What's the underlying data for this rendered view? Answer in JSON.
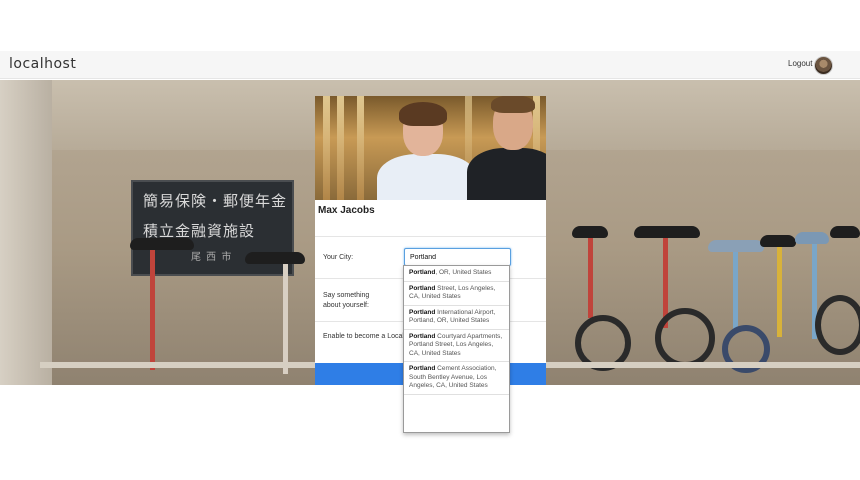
{
  "navbar": {
    "brand": "localhost",
    "logout_label": "Logout"
  },
  "background_sign": {
    "line1": "簡易保険・郵便年金",
    "line2": "積立金融資施設",
    "line3": "尾 西 市"
  },
  "profile": {
    "name": "Max Jacobs"
  },
  "form": {
    "city_label": "Your City:",
    "city_value": "Portland",
    "about_label_1": "Say something",
    "about_label_2": "about yourself:",
    "local_label": "Enable to become a Local"
  },
  "suggestions": [
    {
      "match": "Portland",
      "rest": ", OR, United States"
    },
    {
      "match": "Portland",
      "rest": " Street, Los Angeles, CA, United States"
    },
    {
      "match": "Portland",
      "rest": " International Airport, Portland, OR, United States"
    },
    {
      "match": "Portland",
      "rest": " Courtyard Apartments, Portland Street, Los Angeles, CA, United States"
    },
    {
      "match": "Portland",
      "rest": " Cement Association, South Bentley Avenue, Los Angeles, CA, United States"
    }
  ],
  "colors": {
    "accent": "#2f7ee6",
    "input_focus": "#5aa0e0",
    "navbar_bg": "#f6f6f6"
  },
  "icons": {
    "avatar": "user-avatar-photo"
  }
}
